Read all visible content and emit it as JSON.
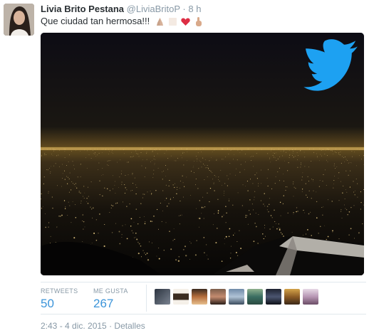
{
  "tweet": {
    "author_name": "Livia Brito Pestana",
    "handle": "@LiviaBritoP",
    "separator": "·",
    "time_ago": "8 h",
    "text": "Que ciudad tan hermosa!!!",
    "emojis": [
      "folded-hands-icon",
      "folded-hands-icon",
      "red-heart-icon",
      "hand-pointing-icon"
    ]
  },
  "stats": {
    "retweets_label": "RETWEETS",
    "retweets_value": "50",
    "likes_label": "ME GUSTA",
    "likes_value": "267"
  },
  "likers_count": 9,
  "footer": {
    "datetime": "2:43 - 4 dic. 2015",
    "separator": "·",
    "details_label": "Detalles"
  },
  "colors": {
    "link_blue": "#3b94d9",
    "twitter_blue": "#1da1f2",
    "muted": "#8899a6"
  }
}
